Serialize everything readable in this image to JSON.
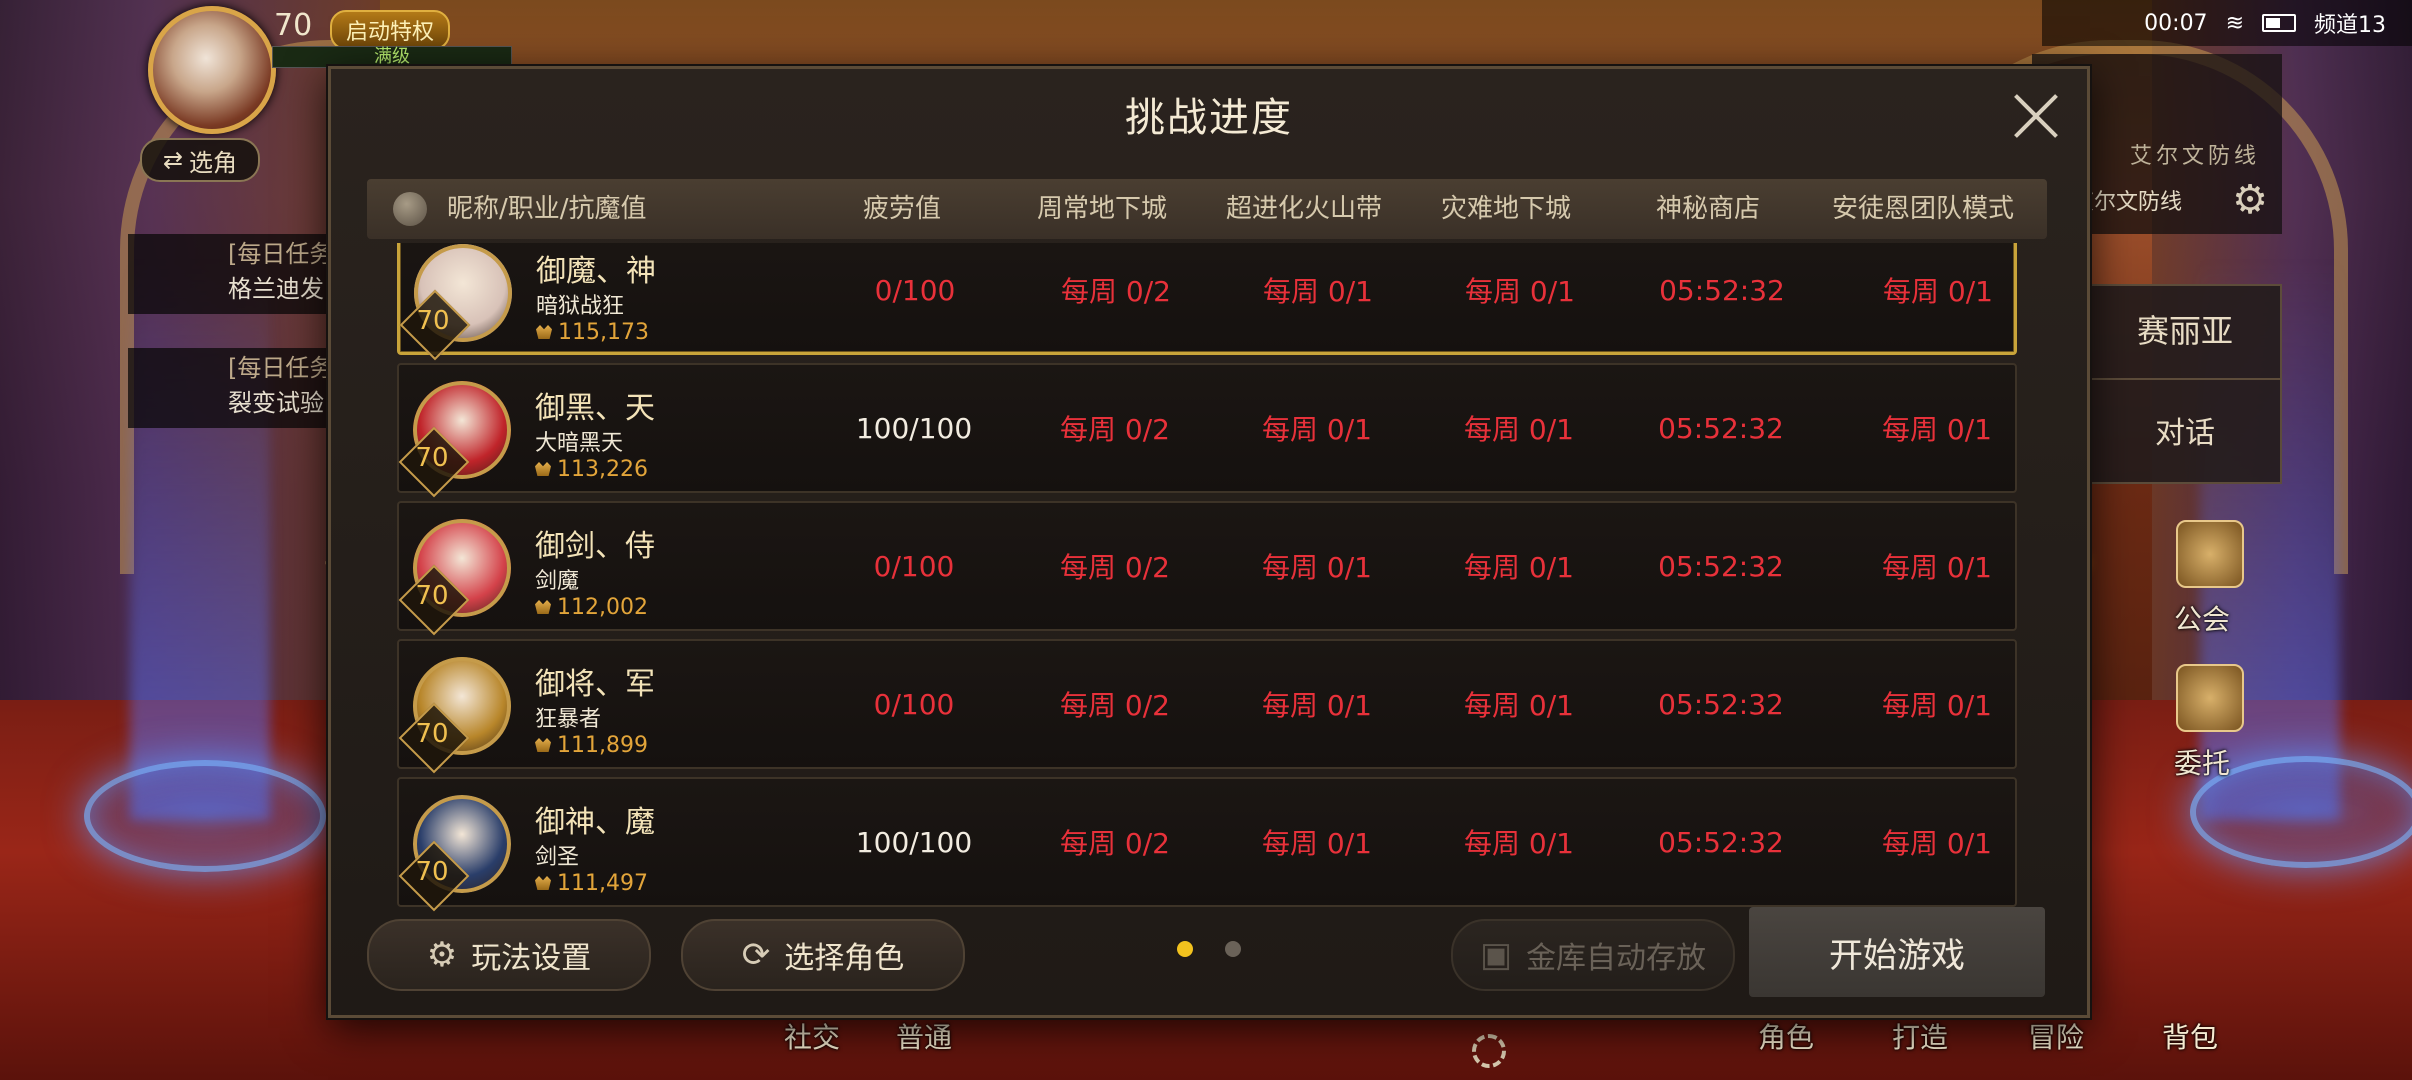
{
  "status": {
    "time": "00:07",
    "channel": "频道13"
  },
  "hud": {
    "level": "70",
    "privilege": "启动特权",
    "max_label": "满级",
    "switch_label": "选角",
    "quests": [
      {
        "title": "[每日任务",
        "desc": "格兰迪发"
      },
      {
        "title": "[每日任务",
        "desc": "裂变试验"
      }
    ],
    "right_text1": "艾尔文防线",
    "right_text2": "艾尔文防线",
    "npc_name": "赛丽亚",
    "npc_talk": "对话",
    "side": [
      "对话",
      "公会",
      "委托"
    ],
    "bottom": [
      "社交",
      "普通",
      "角色",
      "打造",
      "冒险",
      "背包"
    ]
  },
  "dialog": {
    "title": "挑战进度",
    "columns": [
      "昵称/职业/抗魔值",
      "疲劳值",
      "周常地下城",
      "超进化火山带",
      "灾难地下城",
      "神秘商店",
      "安徒恩团队模式"
    ],
    "rows": [
      {
        "name": "御魔、神",
        "job": "暗狱战狂",
        "level": "70",
        "power": "115,173",
        "fatigue": "0/100",
        "weekly": "每周 0/2",
        "volcano": "每周 0/1",
        "disaster": "每周 0/1",
        "shop": "05:52:32",
        "anton": "每周 0/1",
        "selected": true,
        "fatigue_full": false,
        "portrait": "#d8c2b8"
      },
      {
        "name": "御黑、天",
        "job": "大暗黑天",
        "level": "70",
        "power": "113,226",
        "fatigue": "100/100",
        "weekly": "每周 0/2",
        "volcano": "每周 0/1",
        "disaster": "每周 0/1",
        "shop": "05:52:32",
        "anton": "每周 0/1",
        "selected": false,
        "fatigue_full": true,
        "portrait": "#c0242a"
      },
      {
        "name": "御剑、侍",
        "job": "剑魔",
        "level": "70",
        "power": "112,002",
        "fatigue": "0/100",
        "weekly": "每周 0/2",
        "volcano": "每周 0/1",
        "disaster": "每周 0/1",
        "shop": "05:52:32",
        "anton": "每周 0/1",
        "selected": false,
        "fatigue_full": false,
        "portrait": "#d4424a"
      },
      {
        "name": "御将、军",
        "job": "狂暴者",
        "level": "70",
        "power": "111,899",
        "fatigue": "0/100",
        "weekly": "每周 0/2",
        "volcano": "每周 0/1",
        "disaster": "每周 0/1",
        "shop": "05:52:32",
        "anton": "每周 0/1",
        "selected": false,
        "fatigue_full": false,
        "portrait": "#b8862a"
      },
      {
        "name": "御神、魔",
        "job": "剑圣",
        "level": "70",
        "power": "111,497",
        "fatigue": "100/100",
        "weekly": "每周 0/2",
        "volcano": "每周 0/1",
        "disaster": "每周 0/1",
        "shop": "05:52:32",
        "anton": "每周 0/1",
        "selected": false,
        "fatigue_full": true,
        "portrait": "#2a3e6a"
      }
    ],
    "buttons": {
      "settings": "玩法设置",
      "select_char": "选择角色",
      "auto_store": "金库自动存放",
      "start": "开始游戏"
    }
  }
}
